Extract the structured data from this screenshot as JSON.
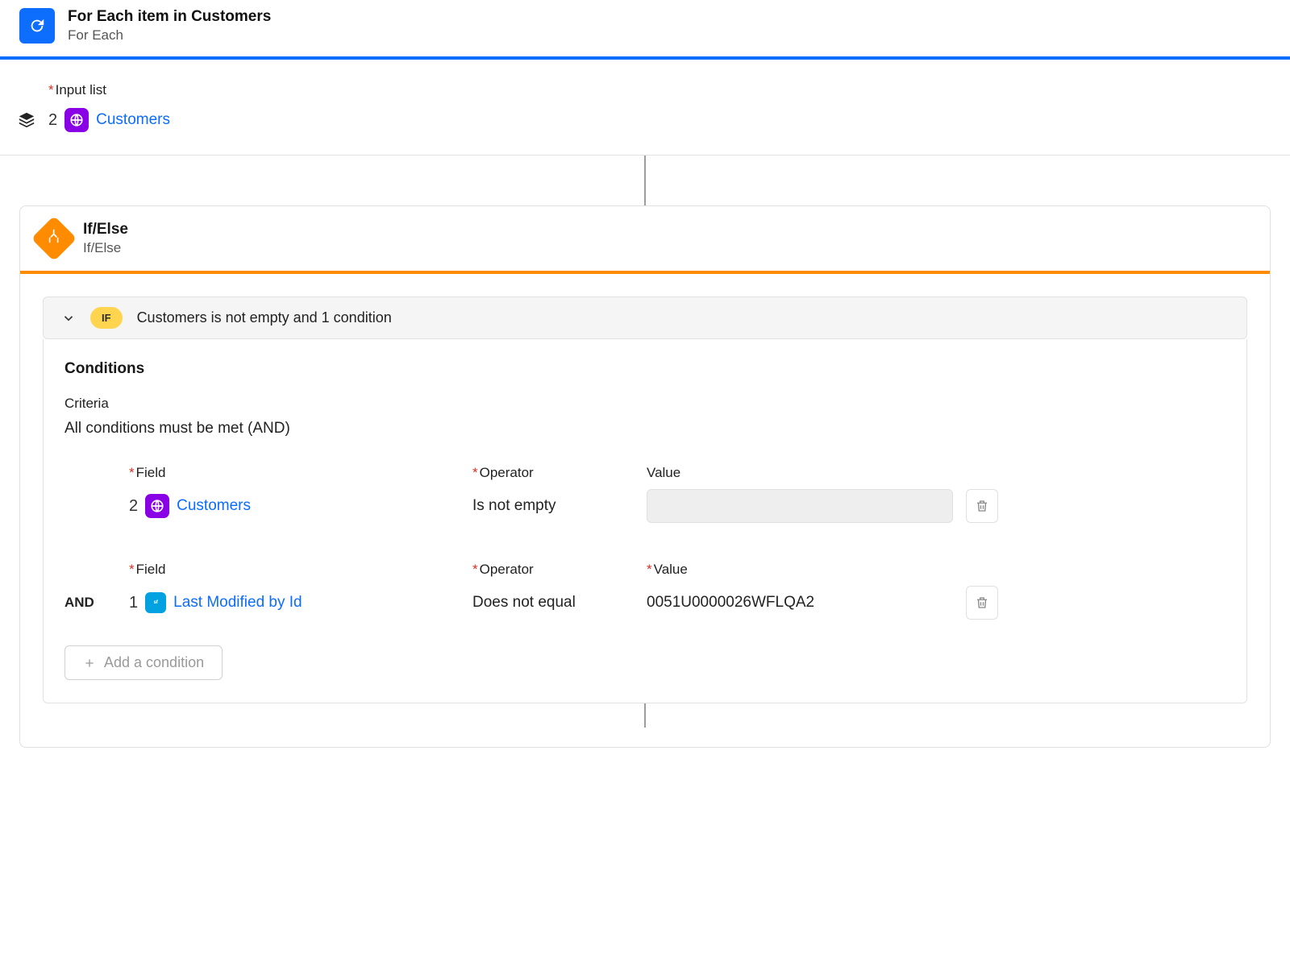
{
  "foreach": {
    "title": "For Each item in Customers",
    "subtitle": "For Each",
    "inputListLabel": "Input list",
    "stepNumber": "2",
    "pillText": "Customers"
  },
  "ifelse": {
    "title": "If/Else",
    "subtitle": "If/Else",
    "ifChip": "IF",
    "summary": "Customers is not empty and 1 condition",
    "conditionsHeading": "Conditions",
    "criteriaLabel": "Criteria",
    "criteriaValue": "All conditions must be met (AND)",
    "labels": {
      "field": "Field",
      "operator": "Operator",
      "value": "Value",
      "and": "AND"
    },
    "rows": [
      {
        "and": "",
        "stepNum": "2",
        "fieldText": "Customers",
        "fieldIcon": "globe",
        "operator": "Is not empty",
        "valueRequired": false,
        "value": "",
        "valueDisabled": true
      },
      {
        "and": "AND",
        "stepNum": "1",
        "fieldText": "Last Modified by Id",
        "fieldIcon": "salesforce",
        "operator": "Does not equal",
        "valueRequired": true,
        "value": "0051U0000026WFLQA2",
        "valueDisabled": false
      }
    ],
    "addConditionLabel": "Add a condition"
  }
}
